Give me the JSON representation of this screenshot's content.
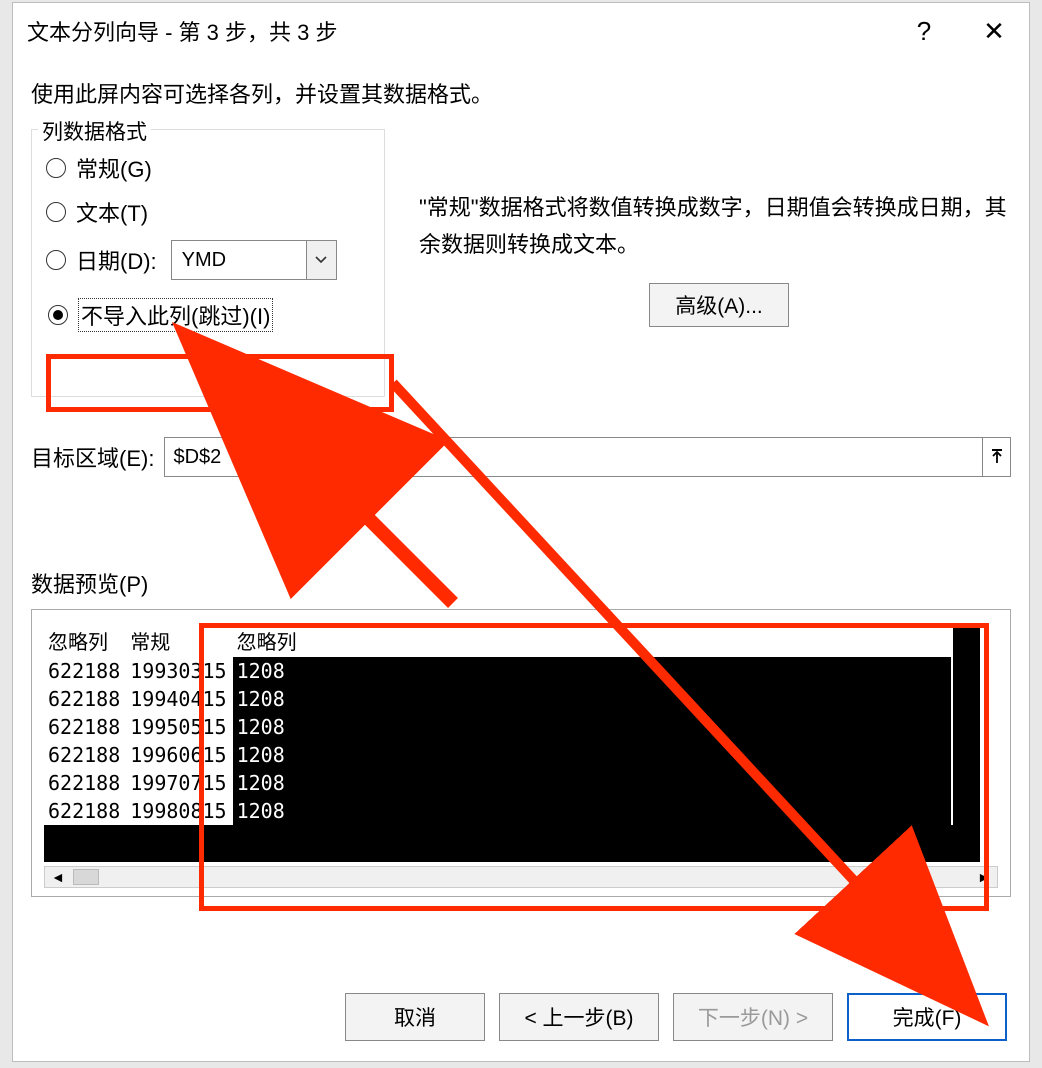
{
  "titlebar": {
    "title": "文本分列向导 - 第 3 步，共 3 步",
    "help": "?",
    "close": "✕"
  },
  "instruction": "使用此屏内容可选择各列，并设置其数据格式。",
  "group": {
    "legend": "列数据格式",
    "general": "常规(G)",
    "text": "文本(T)",
    "date": "日期(D):",
    "date_option": "YMD",
    "skip": "不导入此列(跳过)(I)",
    "selected": "skip"
  },
  "hint": "\"常规\"数据格式将数值转换成数字，日期值会转换成日期，其余数据则转换成文本。",
  "advanced_label": "高级(A)...",
  "destination": {
    "label": "目标区域(E):",
    "value": "$D$2"
  },
  "preview": {
    "legend": "数据预览(P)",
    "headers": [
      "忽略列",
      "常规",
      "忽略列"
    ],
    "rows": [
      [
        "622188",
        "19930315",
        "1208"
      ],
      [
        "622188",
        "19940415",
        "1208"
      ],
      [
        "622188",
        "19950515",
        "1208"
      ],
      [
        "622188",
        "19960615",
        "1208"
      ],
      [
        "622188",
        "19970715",
        "1208"
      ],
      [
        "622188",
        "19980815",
        "1208"
      ]
    ]
  },
  "buttons": {
    "cancel": "取消",
    "back": "< 上一步(B)",
    "next": "下一步(N) >",
    "finish": "完成(F)"
  }
}
